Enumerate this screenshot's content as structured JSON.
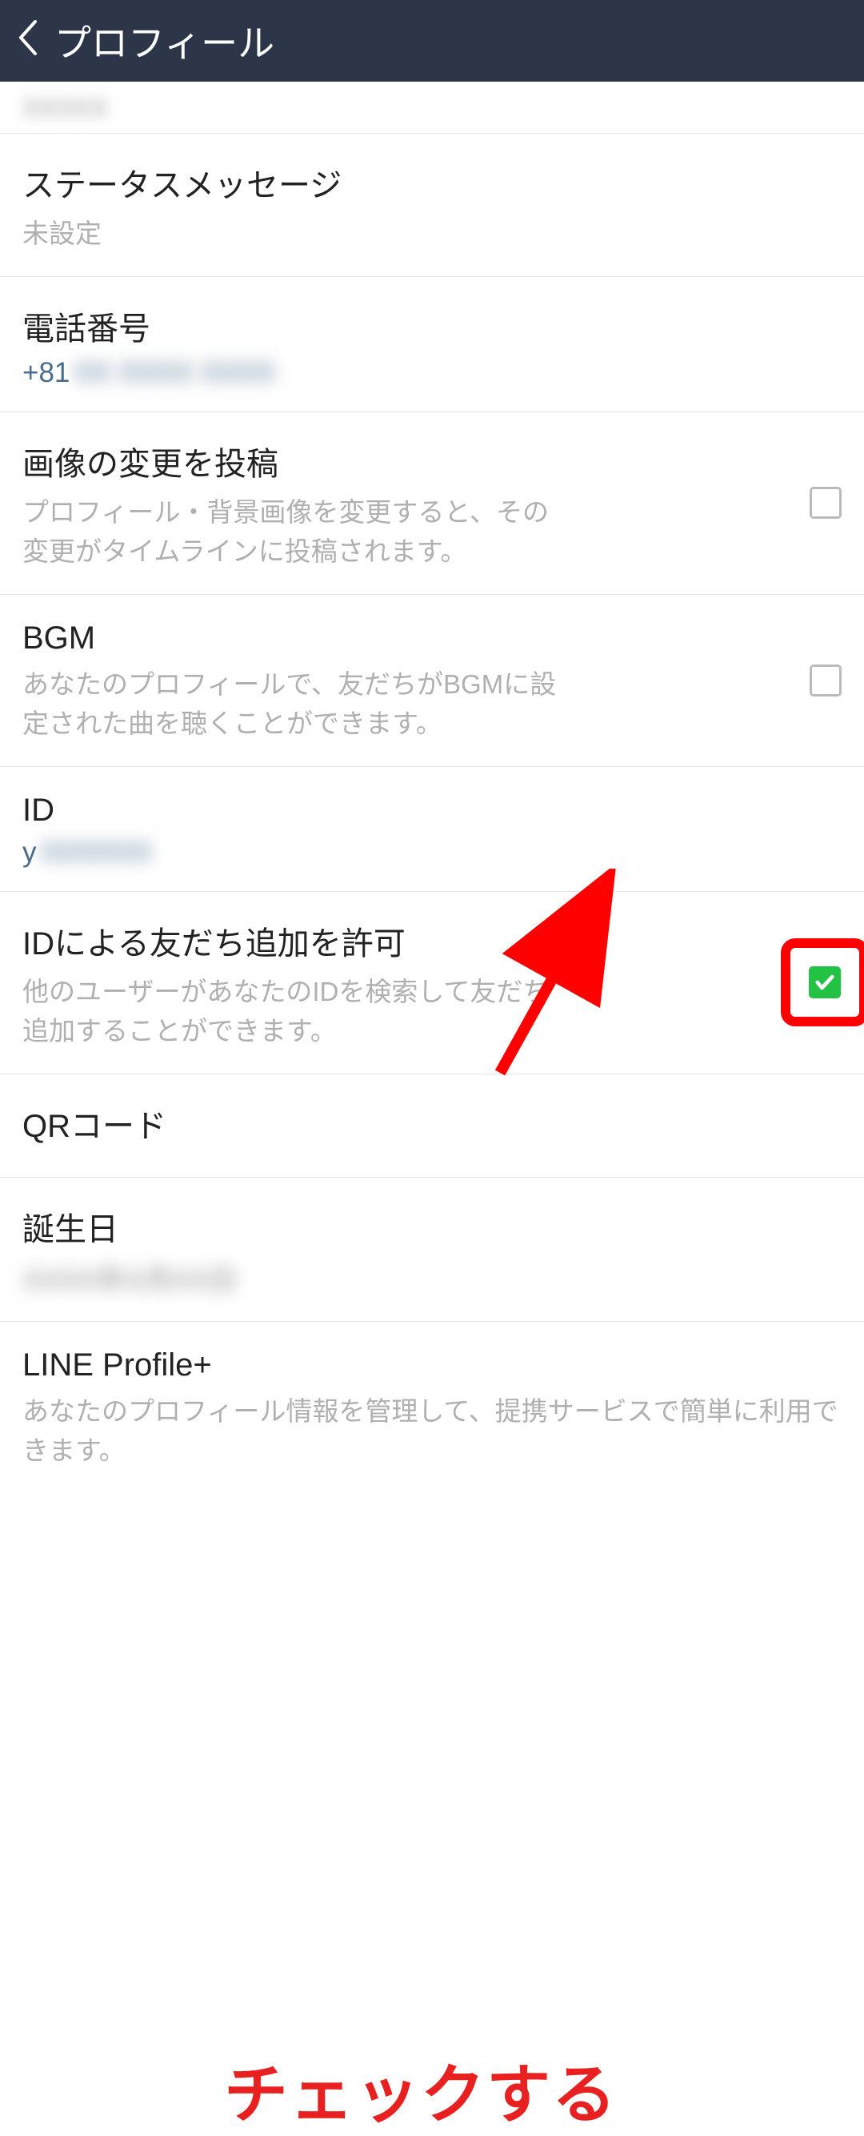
{
  "header": {
    "title": "プロフィール"
  },
  "sections": {
    "statusMessage": {
      "title": "ステータスメッセージ",
      "value": "未設定"
    },
    "phone": {
      "title": "電話番号",
      "value": "+81"
    },
    "imagePost": {
      "title": "画像の変更を投稿",
      "subtitle": "プロフィール・背景画像を変更すると、その変更がタイムラインに投稿されます。",
      "checked": false
    },
    "bgm": {
      "title": "BGM",
      "subtitle": "あなたのプロフィールで、友だちがBGMに設定された曲を聴くことができます。",
      "checked": false
    },
    "id": {
      "title": "ID",
      "value": "y"
    },
    "idAllow": {
      "title": "IDによる友だち追加を許可",
      "subtitle": "他のユーザーがあなたのIDを検索して友だち追加することができます。",
      "checked": true
    },
    "qr": {
      "title": "QRコード"
    },
    "birthday": {
      "title": "誕生日"
    },
    "profilePlus": {
      "title": "LINE Profile+",
      "subtitle": "あなたのプロフィール情報を管理して、提携サービスで簡単に利用できます。"
    }
  },
  "annotation": {
    "text": "チェックする"
  }
}
